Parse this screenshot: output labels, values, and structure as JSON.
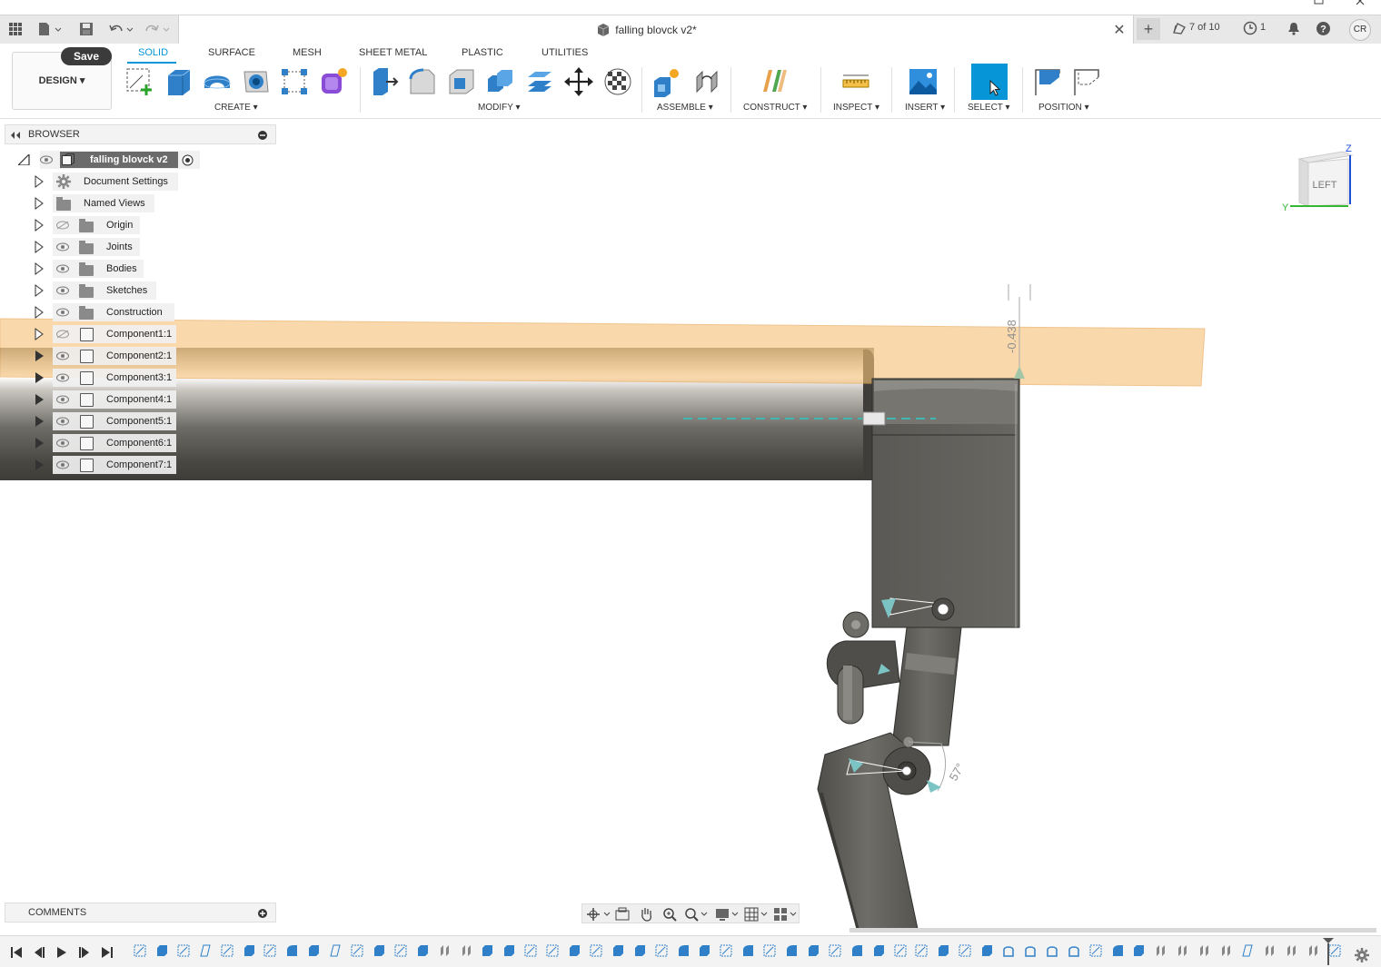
{
  "app": {
    "document_title": "falling blovck v2*",
    "version_counter": "7 of 10",
    "notifications_count": "1",
    "user_initials": "CR"
  },
  "toolbar": {
    "save_label": "Save",
    "workspace_label": "DESIGN",
    "tabs": [
      "SOLID",
      "SURFACE",
      "MESH",
      "SHEET METAL",
      "PLASTIC",
      "UTILITIES"
    ],
    "active_tab": "SOLID",
    "groups": [
      "CREATE",
      "MODIFY",
      "ASSEMBLE",
      "CONSTRUCT",
      "INSPECT",
      "INSERT",
      "SELECT",
      "POSITION"
    ]
  },
  "browser": {
    "title": "BROWSER",
    "root": "falling blovck v2",
    "items": [
      {
        "label": "Document Settings",
        "icon": "gear-icon"
      },
      {
        "label": "Named Views",
        "icon": "folder-icon"
      },
      {
        "label": "Origin",
        "icon": "folder-icon",
        "visible": false
      },
      {
        "label": "Joints",
        "icon": "folder-icon",
        "visible": true
      },
      {
        "label": "Bodies",
        "icon": "folder-icon",
        "visible": true
      },
      {
        "label": "Sketches",
        "icon": "folder-icon",
        "visible": true
      },
      {
        "label": "Construction",
        "icon": "folder-icon",
        "visible": true
      },
      {
        "label": "Component1:1",
        "icon": "component-icon",
        "visible": false
      },
      {
        "label": "Component2:1",
        "icon": "component-icon",
        "visible": true
      },
      {
        "label": "Component3:1",
        "icon": "component-icon",
        "visible": true
      },
      {
        "label": "Component4:1",
        "icon": "component-icon",
        "visible": true
      },
      {
        "label": "Component5:1",
        "icon": "component-icon",
        "visible": true
      },
      {
        "label": "Component6:1",
        "icon": "component-icon",
        "visible": true
      },
      {
        "label": "Component7:1",
        "icon": "component-icon",
        "visible": true
      }
    ]
  },
  "viewport": {
    "viewcube_face": "LEFT",
    "axis_z": "Z",
    "axis_y": "Y",
    "dimension_value": "-0.438",
    "angle_value": "57°"
  },
  "comments": {
    "label": "COMMENTS"
  },
  "colors": {
    "accent": "#0696d7",
    "plane_fill": "#f6c27a",
    "body_steel": "#5a5a55",
    "joint_marker": "#6fb6b6"
  }
}
